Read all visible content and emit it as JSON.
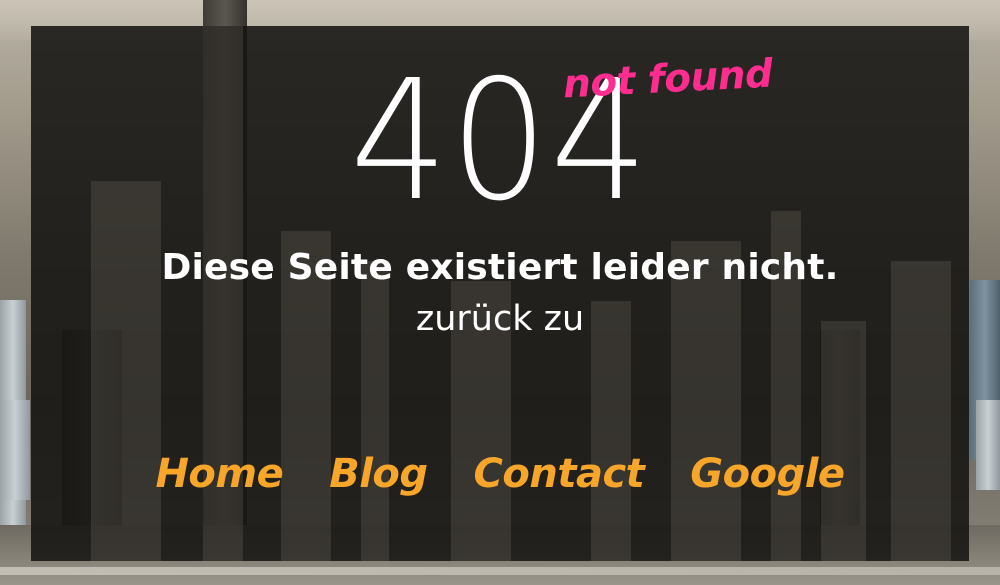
{
  "error": {
    "code": "404",
    "tagline": "not found",
    "message": "Diese Seite existiert leider nicht.",
    "back_prompt": "zurück zu"
  },
  "nav": {
    "links": [
      {
        "label": "Home"
      },
      {
        "label": "Blog"
      },
      {
        "label": "Contact"
      },
      {
        "label": "Google"
      }
    ]
  },
  "colors": {
    "tagline": "#ff2d8f",
    "links": "#f7a62a",
    "text": "#ffffff",
    "panel": "#161412"
  }
}
